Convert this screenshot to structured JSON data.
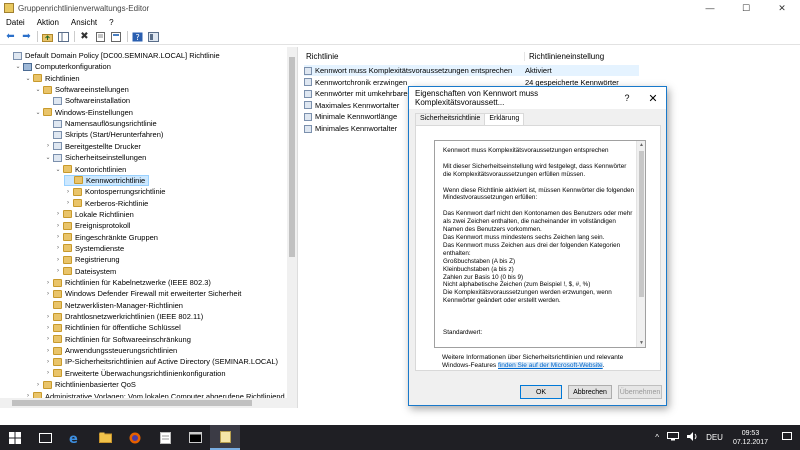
{
  "window": {
    "title": "Gruppenrichtlinienverwaltungs-Editor",
    "minimize": "—",
    "maximize": "☐",
    "close": "✕"
  },
  "menu": [
    "Datei",
    "Aktion",
    "Ansicht",
    "?"
  ],
  "tree": {
    "items": [
      {
        "label": "Default Domain Policy [DC00.SEMINAR.LOCAL] Richtlinie",
        "icon": "policy",
        "exp": ""
      },
      {
        "label": "Computerkonfiguration",
        "icon": "computer",
        "exp": "⌄"
      },
      {
        "label": "Richtlinien",
        "icon": "folder",
        "exp": "⌄"
      },
      {
        "label": "Softwareeinstellungen",
        "icon": "folder",
        "exp": "⌄"
      },
      {
        "label": "Softwareinstallation",
        "icon": "doc",
        "exp": ""
      },
      {
        "label": "Windows-Einstellungen",
        "icon": "folder",
        "exp": "⌄"
      },
      {
        "label": "Namensauflösungsrichtlinie",
        "icon": "doc",
        "exp": ""
      },
      {
        "label": "Skripts (Start/Herunterfahren)",
        "icon": "doc",
        "exp": ""
      },
      {
        "label": "Bereitgestellte Drucker",
        "icon": "doc",
        "exp": "›"
      },
      {
        "label": "Sicherheitseinstellungen",
        "icon": "doc",
        "exp": "⌄"
      },
      {
        "label": "Kontorichtlinien",
        "icon": "folder",
        "exp": "⌄"
      },
      {
        "label": "Kennwortrichtlinie",
        "icon": "folder",
        "exp": ""
      },
      {
        "label": "Kontosperrungsrichtlinie",
        "icon": "folder",
        "exp": "›"
      },
      {
        "label": "Kerberos-Richtlinie",
        "icon": "folder",
        "exp": "›"
      },
      {
        "label": "Lokale Richtlinien",
        "icon": "folder",
        "exp": "›"
      },
      {
        "label": "Ereignisprotokoll",
        "icon": "folder",
        "exp": "›"
      },
      {
        "label": "Eingeschränkte Gruppen",
        "icon": "folder",
        "exp": "›"
      },
      {
        "label": "Systemdienste",
        "icon": "folder",
        "exp": "›"
      },
      {
        "label": "Registrierung",
        "icon": "folder",
        "exp": "›"
      },
      {
        "label": "Dateisystem",
        "icon": "folder",
        "exp": "›"
      },
      {
        "label": "Richtlinien für Kabelnetzwerke (IEEE 802.3)",
        "icon": "folder",
        "exp": "›"
      },
      {
        "label": "Windows Defender Firewall mit erweiterter Sicherheit",
        "icon": "folder",
        "exp": "›"
      },
      {
        "label": "Netzwerklisten-Manager-Richtlinien",
        "icon": "folder",
        "exp": ""
      },
      {
        "label": "Drahtlosnetzwerkrichtlinien (IEEE 802.11)",
        "icon": "folder",
        "exp": "›"
      },
      {
        "label": "Richtlinien für öffentliche Schlüssel",
        "icon": "folder",
        "exp": "›"
      },
      {
        "label": "Richtlinien für Softwareeinschränkung",
        "icon": "folder",
        "exp": "›"
      },
      {
        "label": "Anwendungssteuerungsrichtlinien",
        "icon": "folder",
        "exp": "›"
      },
      {
        "label": "IP-Sicherheitsrichtlinien auf Active Directory (SEMINAR.LOCAL)",
        "icon": "folder",
        "exp": "›"
      },
      {
        "label": "Erweiterte Überwachungsrichtlinienkonfiguration",
        "icon": "folder",
        "exp": "›"
      },
      {
        "label": "Richtlinienbasierter QoS",
        "icon": "folder",
        "exp": "›"
      },
      {
        "label": "Administrative Vorlagen: Vom lokalen Computer abgerufene Richtliniend",
        "icon": "folder",
        "exp": "›"
      }
    ]
  },
  "list": {
    "col_policy": "Richtlinie",
    "col_setting": "Richtlinieneinstellung",
    "rows": [
      {
        "name": "Kennwort muss Komplexitätsvoraussetzungen entsprechen",
        "value": "Aktiviert"
      },
      {
        "name": "Kennwortchronik erzwingen",
        "value": "24 gespeicherte Kennwörter"
      },
      {
        "name": "Kennwörter mit umkehrbarer",
        "value": ""
      },
      {
        "name": "Maximales Kennwortalter",
        "value": ""
      },
      {
        "name": "Minimale Kennwortlänge",
        "value": ""
      },
      {
        "name": "Minimales Kennwortalter",
        "value": ""
      }
    ]
  },
  "dialog": {
    "title": "Eigenschaften von Kennwort muss Komplexitätsvoraussett...",
    "help": "?",
    "close": "✕",
    "tabs": [
      "Sicherheitsrichtlinie",
      "Erklärung"
    ],
    "explanation": "Kennwort muss Komplexitätsvoraussetzungen entsprechen\n\nMit dieser Sicherheitseinstellung wird festgelegt, dass Kennwörter die Komplexitätsvoraussetzungen erfüllen müssen.\n\nWenn diese Richtlinie aktiviert ist, müssen Kennwörter die folgenden Mindestvoraussetzungen erfüllen:\n\nDas Kennwort darf nicht den Kontonamen des Benutzers oder mehr als zwei Zeichen enthalten, die nacheinander im vollständigen Namen des Benutzers vorkommen.\nDas Kennwort muss mindestens sechs Zeichen lang sein.\nDas Kennwort muss Zeichen aus drei der folgenden Kategorien enthalten:\nGroßbuchstaben (A bis Z)\nKleinbuchstaben (a bis z)\nZahlen zur Basis 10 (0 bis 9)\nNicht alphabetische Zeichen (zum Beispiel !, $, #, %)\nDie Komplexitätsvoraussetzungen werden erzwungen, wenn Kennwörter geändert oder erstellt werden.\n\n\n\nStandardwert:",
    "more_info": "Weitere Informationen über Sicherheitsrichtlinien und relevante Windows-Features",
    "link": "finden Sie auf der Microsoft-Website",
    "link_end": ".",
    "ok": "OK",
    "cancel": "Abbrechen",
    "apply": "Übernehmen"
  },
  "taskbar": {
    "time": "09:53",
    "date": "07.12.2017",
    "tray_chevron": "^",
    "lang": "DEU"
  }
}
